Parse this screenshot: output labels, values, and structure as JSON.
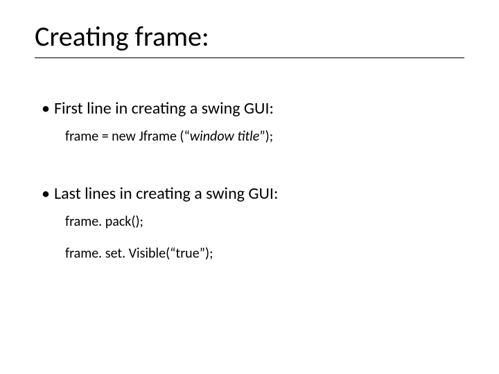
{
  "title": "Creating frame:",
  "sections": [
    {
      "bullet": "•",
      "heading": "First line in creating a swing GUI:",
      "codeLines": [
        {
          "prefix": "frame = new  Jframe (“",
          "italic": "window title",
          "suffix": "”);"
        }
      ]
    },
    {
      "bullet": "•",
      "heading": "Last lines in creating a swing GUI:",
      "codeLines": [
        {
          "prefix": "frame. pack();",
          "italic": "",
          "suffix": ""
        },
        {
          "prefix": "frame. set. Visible(“true”);",
          "italic": "",
          "suffix": ""
        }
      ]
    }
  ]
}
